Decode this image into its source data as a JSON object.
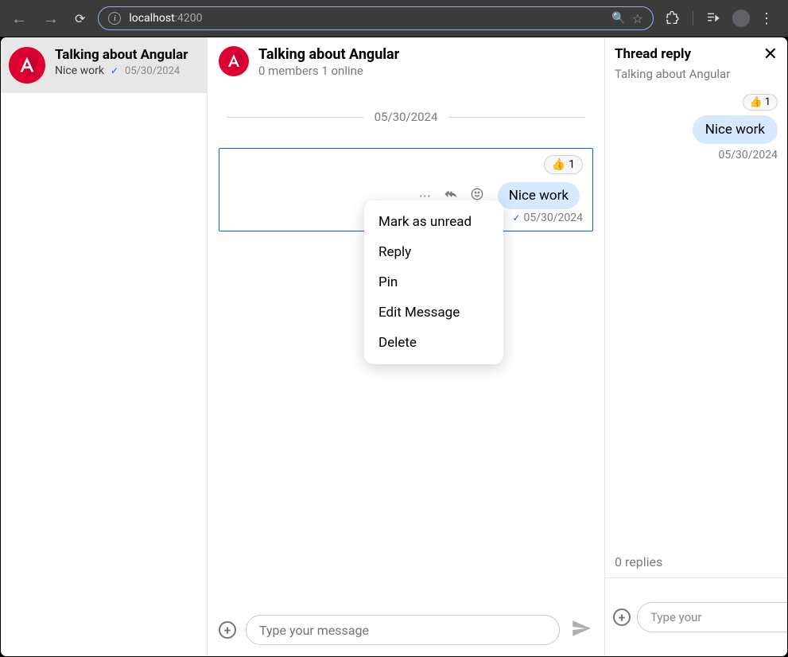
{
  "browser": {
    "url_host": "localhost",
    "url_port": ":4200"
  },
  "sidebar": {
    "channel": {
      "name": "Talking about Angular",
      "preview": "Nice work",
      "date": "05/30/2024"
    }
  },
  "chat": {
    "title": "Talking about Angular",
    "subtitle": "0 members 1 online",
    "date_separator": "05/30/2024",
    "message": {
      "reaction_emoji": "👍",
      "reaction_count": "1",
      "text": "Nice work",
      "timestamp": "05/30/2024"
    },
    "context_menu": {
      "items": [
        "Mark as unread",
        "Reply",
        "Pin",
        "Edit Message",
        "Delete"
      ]
    },
    "composer": {
      "placeholder": "Type your message"
    }
  },
  "thread": {
    "title": "Thread reply",
    "subtitle": "Talking about Angular",
    "reaction_emoji": "👍",
    "reaction_count": "1",
    "message_text": "Nice work",
    "timestamp": "05/30/2024",
    "replies_text": "0 replies",
    "composer": {
      "placeholder": "Type your"
    }
  }
}
